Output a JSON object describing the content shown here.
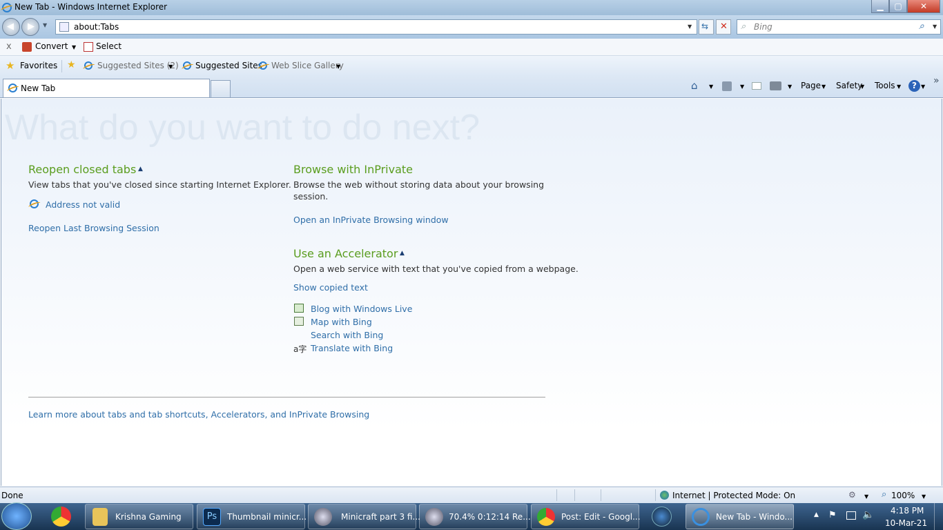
{
  "window": {
    "title": "New Tab - Windows Internet Explorer",
    "minimize": "▁",
    "maximize": "▢",
    "close": "✕"
  },
  "navbar": {
    "address_value": "about:Tabs",
    "search_placeholder": "Bing"
  },
  "command_bar": {
    "close_label": "x",
    "convert_label": "Convert",
    "select_label": "Select"
  },
  "favorites_bar": {
    "favorites_label": "Favorites",
    "items": [
      "Suggested Sites (2)",
      "Suggested Sites",
      "Web Slice Gallery"
    ]
  },
  "tabs": {
    "active_label": "New Tab"
  },
  "toolbar": {
    "page_label": "Page",
    "safety_label": "Safety",
    "tools_label": "Tools",
    "more": "»"
  },
  "content": {
    "headline": "What do you want to do next?",
    "reopen": {
      "heading": "Reopen closed tabs",
      "description": "View tabs that you've closed since starting Internet Explorer.",
      "closed_tab": "Address not valid",
      "last_session": "Reopen Last Browsing Session"
    },
    "inprivate": {
      "heading": "Browse with InPrivate",
      "description_line1": "Browse the web without storing data about your browsing",
      "description_line2": "session.",
      "link": "Open an InPrivate Browsing window"
    },
    "accelerator": {
      "heading": "Use an Accelerator",
      "description": "Open a web service with text that you've copied from a webpage.",
      "show_copied": "Show copied text",
      "items": [
        "Blog with Windows Live",
        "Map with Bing",
        "Search with Bing",
        "Translate with Bing"
      ]
    },
    "learn_more": "Learn more about tabs and tab shortcuts, Accelerators, and InPrivate Browsing"
  },
  "statusbar": {
    "status": "Done",
    "zone": "Internet | Protected Mode: On",
    "zoom": "100%"
  },
  "taskbar": {
    "items": [
      "Krishna Gaming",
      "Thumbnail minicr...",
      "Minicraft part 3 fi...",
      "70.4% 0:12:14 Re...",
      "Post: Edit - Googl...",
      "New Tab - Windo..."
    ],
    "time": "4:18 PM",
    "date": "10-Mar-21"
  },
  "colors": {
    "heading_green": "#5a9d1e",
    "link_blue": "#2f6ea8",
    "taskbar": "#193451"
  }
}
